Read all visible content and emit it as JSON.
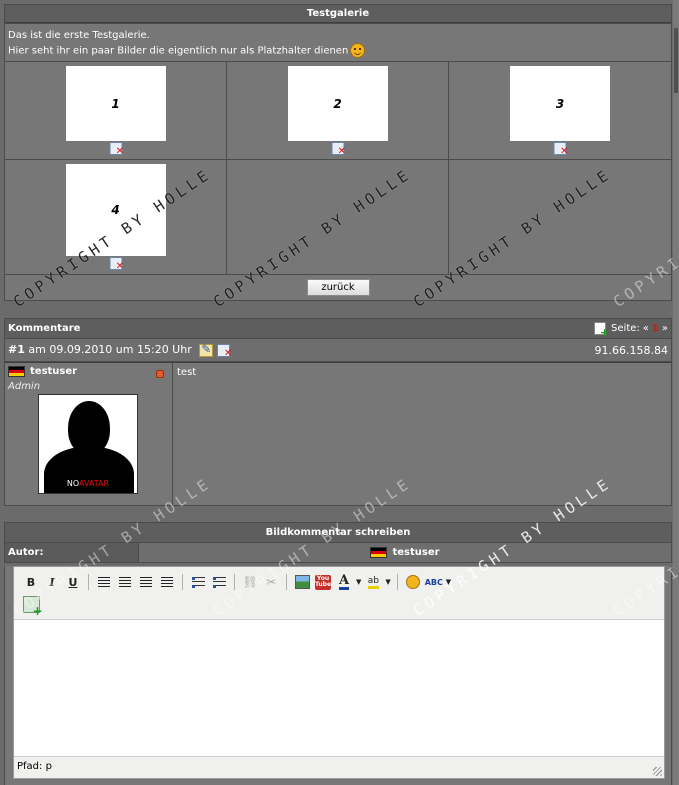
{
  "gallery": {
    "title": "Testgalerie",
    "desc_line1": "Das ist die erste Testgalerie.",
    "desc_line2": "Hier seht ihr ein paar Bilder die eigentlich nur als Platzhalter dienen",
    "images": [
      {
        "label": "1"
      },
      {
        "label": "2"
      },
      {
        "label": "3"
      },
      {
        "label": "4"
      }
    ],
    "back_label": "zurück"
  },
  "comments": {
    "title": "Kommentare",
    "page_label": "Seite:",
    "page_prev": "«",
    "page_current": "1",
    "page_next": "»",
    "items": [
      {
        "number": "#1",
        "meta": "am 09.09.2010 um 15:20 Uhr",
        "ip": "91.66.158.84",
        "user": "testuser",
        "role": "Admin",
        "avatar_text_a": "NO",
        "avatar_text_b": "AVATAR",
        "text": "test"
      }
    ]
  },
  "write": {
    "title": "Bildkommentar schreiben",
    "author_label": "Autor:",
    "author_name": "testuser",
    "toolbar": {
      "bold": "B",
      "italic": "I",
      "underline": "U",
      "youtube": "You Tube",
      "font_color": "A",
      "highlight": "ab",
      "spell": "ABC"
    },
    "path_label": "Pfad: p"
  },
  "watermark": "COPYRIGHT BY HOLLE"
}
